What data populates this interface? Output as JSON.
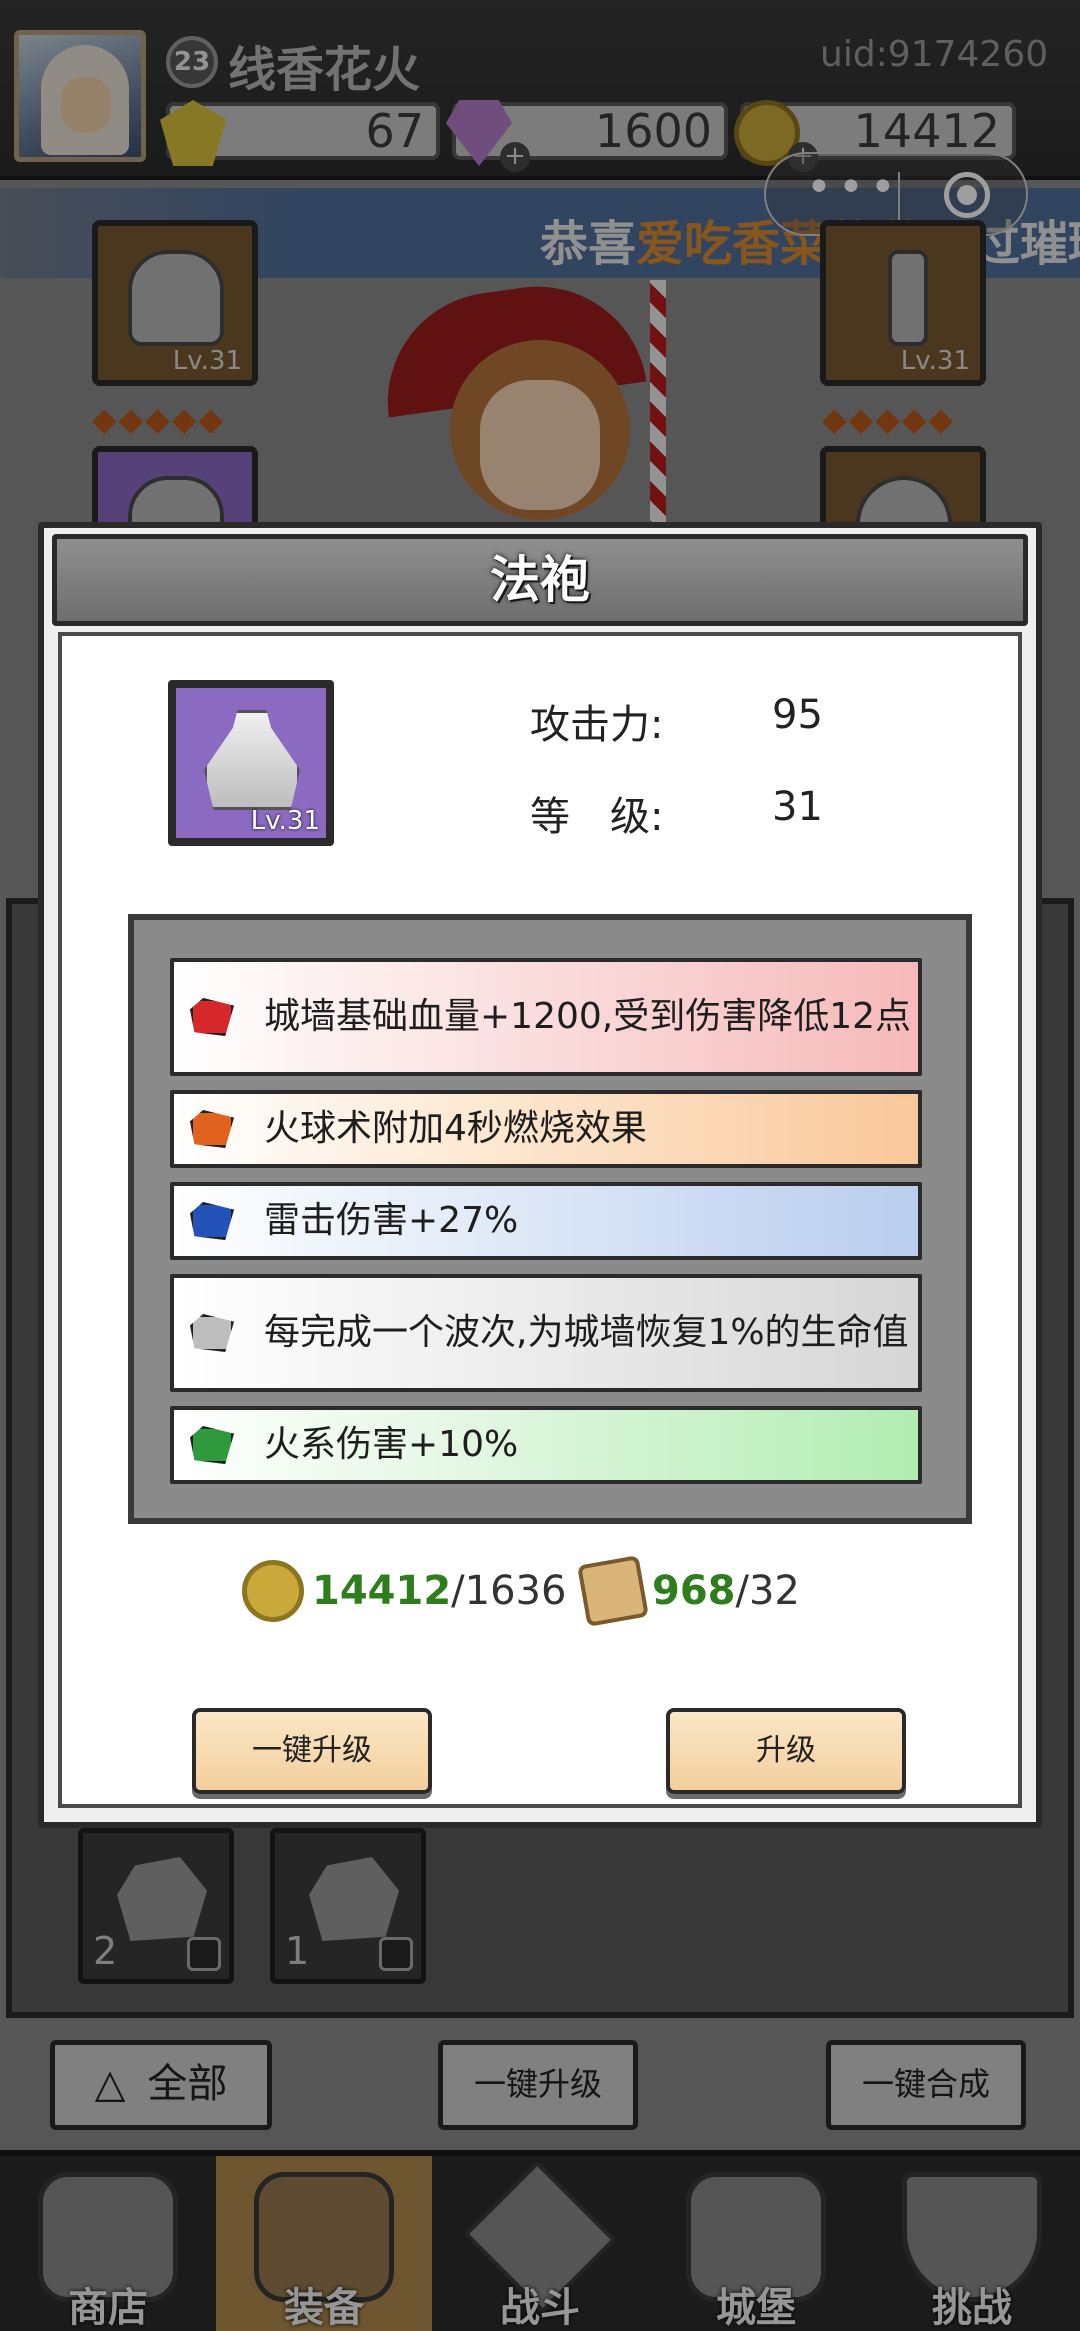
{
  "player": {
    "level": "23",
    "name": "线香花火",
    "uid": "uid:9174260"
  },
  "resources": {
    "gems": "67",
    "diamonds": "1600",
    "coins": "14412"
  },
  "marquee": {
    "prefix": "恭喜",
    "highlight": "爱吃香菜的菜",
    "suffix": "通过璀璨"
  },
  "equipment_slots": {
    "top_left_level": "Lv.31",
    "top_right_level": "Lv.31"
  },
  "modal": {
    "title": "法袍",
    "item_level": "Lv.31",
    "stats": [
      {
        "label": "攻击力:",
        "value": "95"
      },
      {
        "label": "等　级:",
        "value": "31"
      }
    ],
    "affixes": [
      {
        "text": "城墙基础血量+1200,受到伤害降低12点",
        "gem_color": "#d6282a"
      },
      {
        "text": "火球术附加4秒燃烧效果",
        "gem_color": "#e0621e"
      },
      {
        "text": "雷击伤害+27%",
        "gem_color": "#2452b8"
      },
      {
        "text": "每完成一个波次,为城墙恢复1%的生命值",
        "gem_color": "#bdbdbd"
      },
      {
        "text": "火系伤害+10%",
        "gem_color": "#2f9a3c"
      }
    ],
    "cost_coins": {
      "have": "14412",
      "need": "/1636"
    },
    "cost_scrolls": {
      "have": "968",
      "need": "/32"
    },
    "buttons": {
      "upgrade_all": "一键升级",
      "upgrade": "升级"
    }
  },
  "inventory": [
    {
      "count": "2"
    },
    {
      "count": "1"
    }
  ],
  "bottom_actions": {
    "filter": "全部",
    "upgrade_all": "一键升级",
    "merge_all": "一键合成"
  },
  "nav": [
    {
      "label": "商店"
    },
    {
      "label": "装备",
      "active": true
    },
    {
      "label": "战斗"
    },
    {
      "label": "城堡"
    },
    {
      "label": "挑战"
    }
  ],
  "colors": {
    "accent_highlight": "#d98b2e",
    "cost_have": "#2f7d1c",
    "nav_active": "#b08a4e"
  }
}
